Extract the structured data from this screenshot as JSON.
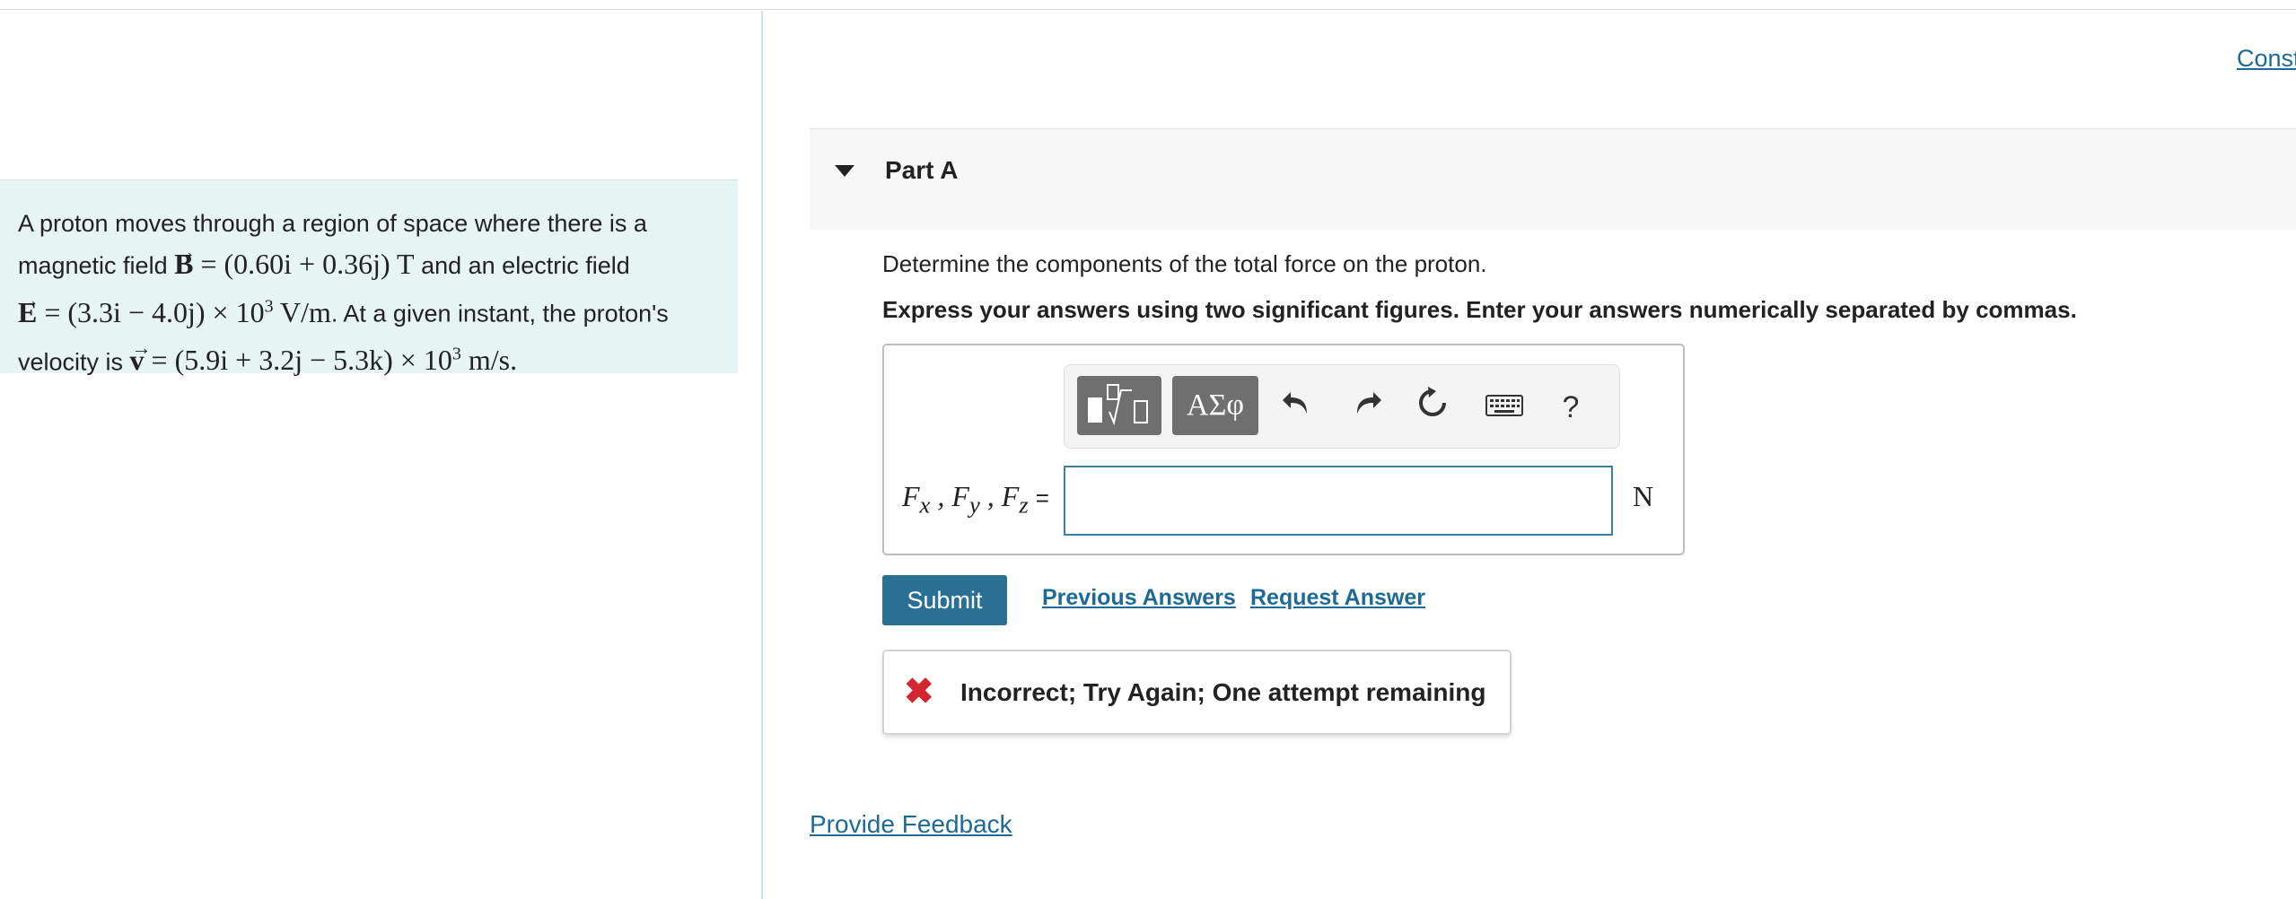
{
  "constants_link": "Const",
  "problem": {
    "line1": "A proton moves through a region of space where there is a",
    "line2_prefix": "magnetic field ",
    "B_symbol": "B",
    "B_value": " = (0.60i + 0.36j) T",
    "line2_suffix": " and an electric field",
    "E_symbol": "E",
    "E_value": " = (3.3i − 4.0j) × 10",
    "E_exp": "3",
    "E_unit": " V/m",
    "line3_suffix": ". At a given instant, the proton's",
    "line4_prefix": "velocity is ",
    "v_symbol": "v",
    "v_value": " = (5.9i + 3.2j − 5.3k) × 10",
    "v_exp": "3",
    "v_unit": " m/s",
    "line4_suffix": "."
  },
  "part": {
    "title": "Part A"
  },
  "instructions": {
    "line1": "Determine the components of the total force on the proton.",
    "line2": "Express your answers using two significant figures. Enter your answers numerically separated by commas."
  },
  "toolbar": {
    "greek_label": "ΑΣφ",
    "help_label": "?",
    "icons": [
      "templates-icon",
      "greek-symbols-icon",
      "undo-icon",
      "redo-icon",
      "reset-icon",
      "keyboard-icon",
      "help-icon"
    ]
  },
  "answer": {
    "label_vars": "Fx , Fy , Fz",
    "equals": "=",
    "value": "",
    "unit": "N"
  },
  "actions": {
    "submit": "Submit",
    "previous_answers": "Previous Answers",
    "request_answer": "Request Answer"
  },
  "feedback": {
    "message": "Incorrect; Try Again; One attempt remaining",
    "color": "#d3262e"
  },
  "provide_feedback": "Provide Feedback"
}
